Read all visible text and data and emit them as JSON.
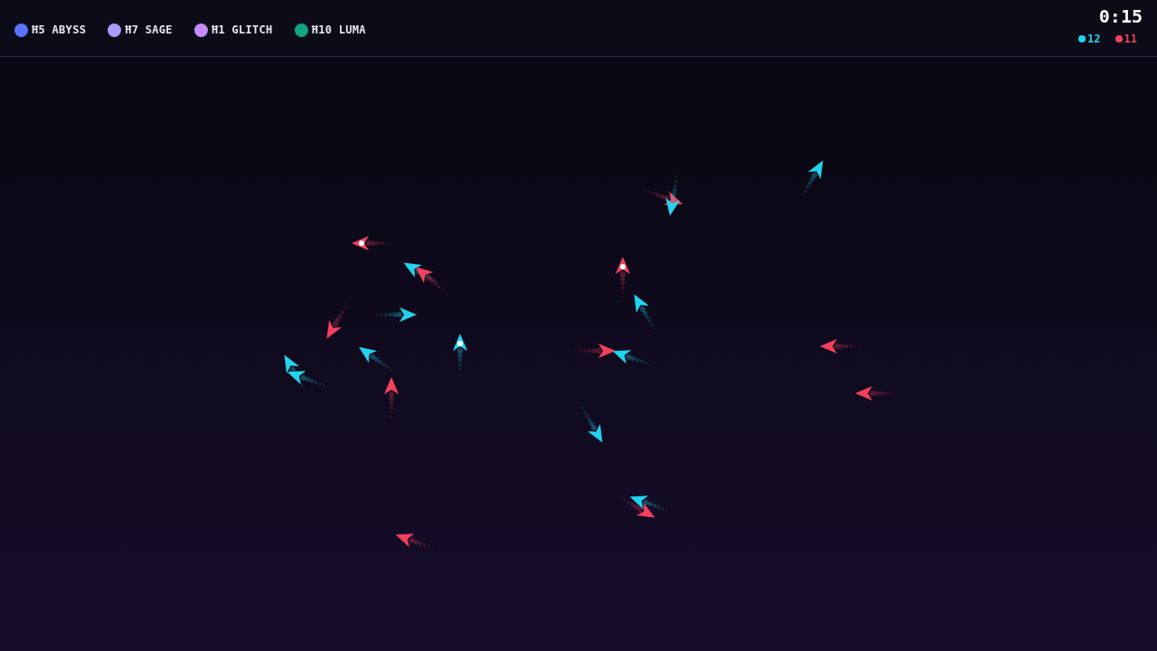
{
  "players": [
    {
      "name": "Ħ5 ABYSS",
      "color": "#5b73ff"
    },
    {
      "name": "Ħ7 SAGE",
      "color": "#a99cff"
    },
    {
      "name": "Ħ1 GLITCH",
      "color": "#c68cff"
    },
    {
      "name": "Ħ10 LUMA",
      "color": "#12a583"
    }
  ],
  "timer": "0:15",
  "scores": [
    {
      "value": "12",
      "color": "#22d3ee"
    },
    {
      "value": "11",
      "color": "#f43f5e"
    }
  ]
}
